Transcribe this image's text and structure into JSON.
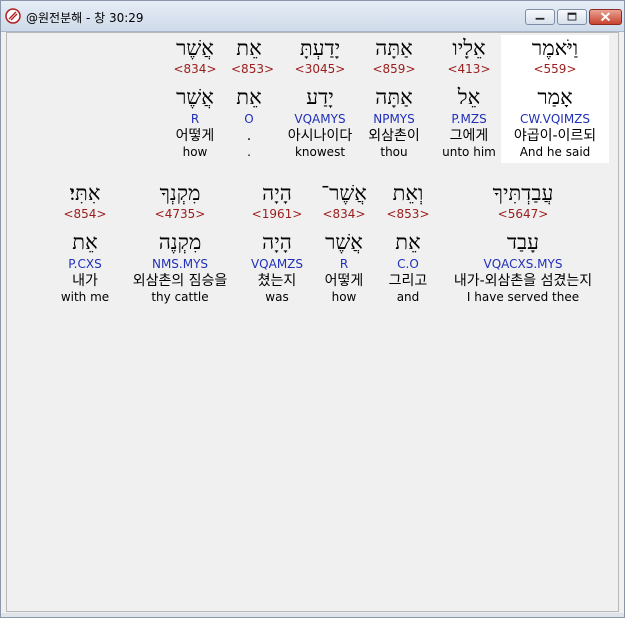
{
  "window": {
    "title": "@원전분해 - 창 30:29"
  },
  "rows": [
    [
      {
        "heb": "וַיֹּאמֶר",
        "num": "<559>",
        "lemma": "אָמַר",
        "morph": "CW.VQIMZS",
        "kor": "야곱이-이르되",
        "eng": "And he said",
        "selected": true
      },
      {
        "heb": "אֵלָיו",
        "num": "<413>",
        "lemma": "אֵל",
        "morph": "P.MZS",
        "kor": "그에게",
        "eng": "unto him"
      },
      {
        "heb": "אַתָּה",
        "num": "<859>",
        "lemma": "אַתָּה",
        "morph": "NPMYS",
        "kor": "외삼촌이",
        "eng": "thou"
      },
      {
        "heb": "יָדַעְתָּ",
        "num": "<3045>",
        "lemma": "יָדַע",
        "morph": "VQAMYS",
        "kor": "아시나이다",
        "eng": "knowest"
      },
      {
        "heb": "אֵת",
        "num": "<853>",
        "lemma": "אֵת",
        "morph": "O",
        "kor": ".",
        "eng": "."
      },
      {
        "heb": "אֲשֶׁר",
        "num": "<834>",
        "lemma": "אֲשֶׁר",
        "morph": "R",
        "kor": "어떻게",
        "eng": "how"
      }
    ],
    [
      {
        "heb": "עֲבַדְתִּיךָ",
        "num": "<5647>",
        "lemma": "עָבַד",
        "morph": "VQACXS.MYS",
        "kor": "내가-외삼촌을 섬겼는지",
        "eng": "I have served thee"
      },
      {
        "heb": "וְאֵת",
        "num": "<853>",
        "lemma": "אֵת",
        "morph": "C.O",
        "kor": "그리고",
        "eng": "and"
      },
      {
        "heb": "אֲשֶׁר־",
        "num": "<834>",
        "lemma": "אֲשֶׁר",
        "morph": "R",
        "kor": "어떻게",
        "eng": "how"
      },
      {
        "heb": "הָיָה",
        "num": "<1961>",
        "lemma": "הָיָה",
        "morph": "VQAMZS",
        "kor": "쳤는지",
        "eng": "was"
      },
      {
        "heb": "מִקְנְךָ",
        "num": "<4735>",
        "lemma": "מִקְנֶה",
        "morph": "NMS.MYS",
        "kor": "외삼촌의 짐승을",
        "eng": "thy cattle"
      },
      {
        "heb": "אִתִּי׃",
        "num": "<854>",
        "lemma": "אֵת",
        "morph": "P.CXS",
        "kor": "내가",
        "eng": "with me"
      }
    ]
  ]
}
